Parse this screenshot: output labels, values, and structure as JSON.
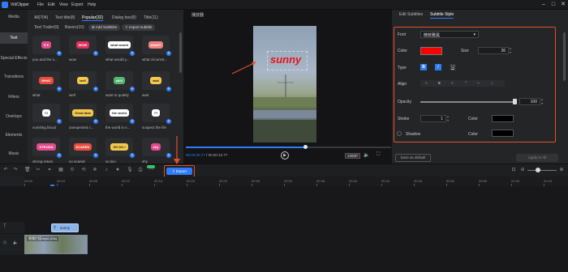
{
  "app": {
    "name": "VidClipper"
  },
  "menu": [
    "File",
    "Edit",
    "View",
    "Export",
    "Help"
  ],
  "window_controls": [
    "–",
    "□",
    "✕"
  ],
  "nav": [
    "Media",
    "Text",
    "Special Effects",
    "Transitions",
    "Filters",
    "Overlays",
    "Elements",
    "Music"
  ],
  "library": {
    "categories": [
      "All(704)",
      "Text title(8)",
      "Popular(32)",
      "Dialog box(8)",
      "Title(11)"
    ],
    "subcategories": [
      "Text Trailer(9)",
      "Basics(10)"
    ],
    "add_subtitles": "Add Subtitles",
    "import_subtitle": "Import subtitle",
    "items": [
      {
        "label": "you and the s...",
        "sticker": "♥ ♥",
        "color": "#e24a8b"
      },
      {
        "label": "wow",
        "sticker": "WOW",
        "color": "#e0315a"
      },
      {
        "label": "what would y...",
        "sticker": "what would",
        "color": "#ffffff"
      },
      {
        "label": "what circumst...",
        "sticker": "what?!",
        "color": "#f08080"
      },
      {
        "label": "what",
        "sticker": "WHAT",
        "color": "#e84c3d"
      },
      {
        "label": "well",
        "sticker": "well",
        "color": "#f2c94c"
      },
      {
        "label": "want to quietly",
        "sticker": "shh!",
        "color": "#56b870"
      },
      {
        "label": "wait",
        "sticker": "wait",
        "color": "#f2c94c"
      },
      {
        "label": "vomiting blood",
        "sticker": "!!!",
        "color": "#ffffff"
      },
      {
        "label": "unexpected c...",
        "sticker": "Great Idea",
        "color": "#f2c94c"
      },
      {
        "label": "the world is n...",
        "sticker": "the world",
        "color": "#ffffff"
      },
      {
        "label": "suspect the life",
        "sticker": "??",
        "color": "#ffffff"
      },
      {
        "label": "strong return",
        "sticker": "STRONG",
        "color": "#e24a8b"
      },
      {
        "label": "so scared",
        "sticker": "SCARED",
        "color": "#e84c3d"
      },
      {
        "label": "so do i",
        "sticker": "SO DO I",
        "color": "#f2c94c"
      },
      {
        "label": "shy",
        "sticker": "shy",
        "color": "#e24a8b"
      }
    ]
  },
  "preview": {
    "title": "播放器",
    "overlay_text": "sunny",
    "time_current": "00:00:00.77",
    "time_total": "00:00:10.77",
    "time_separator": "/",
    "quality": "1080P",
    "progress": 0.58
  },
  "subtitle_panel": {
    "tabs": [
      "Edit Subtitles",
      "Subtitle Style"
    ],
    "font_label": "Font",
    "font_value": "微软雅黑",
    "color_label": "Color",
    "color_value": "#ff0000",
    "size_label": "Size",
    "size_value": "36",
    "type_label": "Type",
    "type_options": [
      "B",
      "I",
      "U"
    ],
    "align_label": "Align",
    "opacity_label": "Opacity",
    "opacity_value": "100",
    "stroke_label": "Stroke",
    "stroke_value": "1",
    "stroke_color_label": "Color",
    "shadow_label": "Shadow",
    "shadow_color_label": "Color",
    "save_default": "Save as default",
    "apply_all": "Apply to All"
  },
  "toolbar": {
    "export_label": "Export"
  },
  "ruler_ticks": [
    "00:00",
    "00:04",
    "00:08",
    "00:12",
    "00:16",
    "00:20",
    "00:24",
    "00:28",
    "00:32",
    "00:36",
    "00:40",
    "00:44",
    "00:48",
    "00:52",
    "00:56",
    "01:00",
    "01:04"
  ],
  "timeline": {
    "text_clip": "sunny",
    "video_clip": "视频片段.mp4 (10s)"
  }
}
